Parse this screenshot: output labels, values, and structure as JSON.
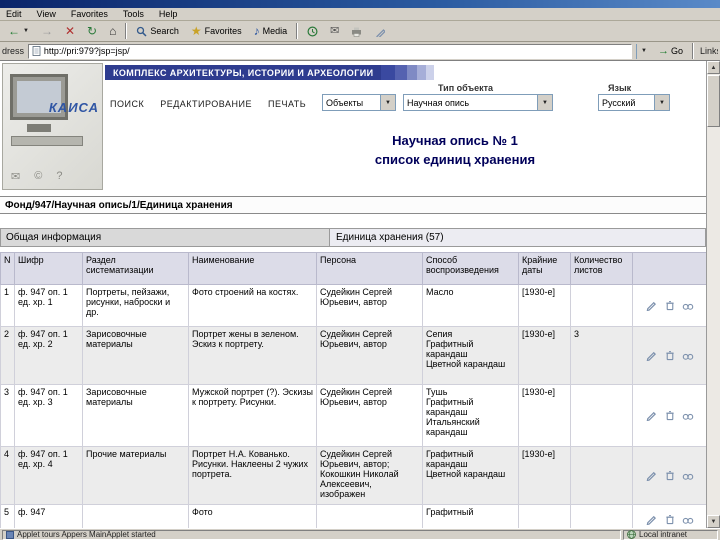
{
  "window": {
    "menu": [
      "Edit",
      "View",
      "Favorites",
      "Tools",
      "Help"
    ],
    "toolbar": {
      "search": "Search",
      "favorites": "Favorites",
      "media": "Media"
    },
    "address": {
      "label": "Address",
      "value": "http://pri:979?jsp=jsp/",
      "go": "Go",
      "links": "Links"
    },
    "status": {
      "left": "Applet tours Appers MainApplet started",
      "right": "Local intranet"
    }
  },
  "app": {
    "banner": "КОМПЛЕКС АРХИТЕКТУРЫ, ИСТОРИИ И АРХЕОЛОГИИ",
    "logo": "КАИСА",
    "nav": [
      "ПОИСК",
      "РЕДАКТИРОВАНИЕ",
      "ПЕЧАТЬ"
    ],
    "labels": {
      "object_type": "Тип объекта",
      "language": "Язык"
    },
    "dropdowns": {
      "objects": "Объекты",
      "object_type": "Научная опись",
      "language": "Русский"
    },
    "title1": "Научная опись № 1",
    "title2": "список единиц хранения",
    "breadcrumb": "Фонд/947/Научная опись/1/Единица хранения",
    "tab_general": "Общая информация",
    "tab_items": "Единица хранения (57)"
  },
  "table": {
    "headers": [
      "N",
      "Шифр",
      "Раздел систематизации",
      "Наименование",
      "Персона",
      "Способ воспроизведения",
      "Крайние даты",
      "Количество листов"
    ],
    "rows": [
      {
        "n": "1",
        "code": "ф. 947 оп. 1 ед. хр. 1",
        "section": "Портреты, пейзажи, рисунки, наброски и др.",
        "name": "Фото строений на костях.",
        "persona": "Судейкин Сергей Юрьевич, автор",
        "method": "Масло",
        "dates": "[1930-е]",
        "sheets": ""
      },
      {
        "n": "2",
        "code": "ф. 947 оп. 1 ед. хр. 2",
        "section": "Зарисовочные материалы",
        "name": "Портрет жены в зеленом. Эскиз к портрету.",
        "persona": "Судейкин Сергей Юрьевич, автор",
        "method": "Сепия\nГрафитный карандаш\nЦветной карандаш",
        "dates": "[1930-е]",
        "sheets": "3"
      },
      {
        "n": "3",
        "code": "ф. 947 оп. 1 ед. хр. 3",
        "section": "Зарисовочные материалы",
        "name": "Мужской портрет (?). Эскизы к портрету. Рисунки.",
        "persona": "Судейкин Сергей Юрьевич, автор",
        "method": "Тушь\nГрафитный карандаш\nИтальянский карандаш",
        "dates": "[1930-е]",
        "sheets": ""
      },
      {
        "n": "4",
        "code": "ф. 947 оп. 1 ед. хр. 4",
        "section": "Прочие материалы",
        "name": "Портрет Н.А. Кованько. Рисунки. Наклеены 2 чужих портрета.",
        "persona": "Судейкин Сергей Юрьевич, автор; Кокошкин Николай Алексеевич, изображен",
        "method": "Графитный карандаш\nЦветной карандаш",
        "dates": "[1930-е]",
        "sheets": ""
      },
      {
        "n": "5",
        "code": "ф. 947",
        "section": "",
        "name": "Фото",
        "persona": "",
        "method": "Графитный",
        "dates": "",
        "sheets": ""
      }
    ]
  },
  "colors": {
    "banner_blue": "#2e3c8f",
    "title_text": "#00005a",
    "table_header_bg": "#dcdce8",
    "row_alt_bg": "#ececec",
    "chrome_gray": "#d4d0c8",
    "logo_blue": "#2f55a4"
  }
}
